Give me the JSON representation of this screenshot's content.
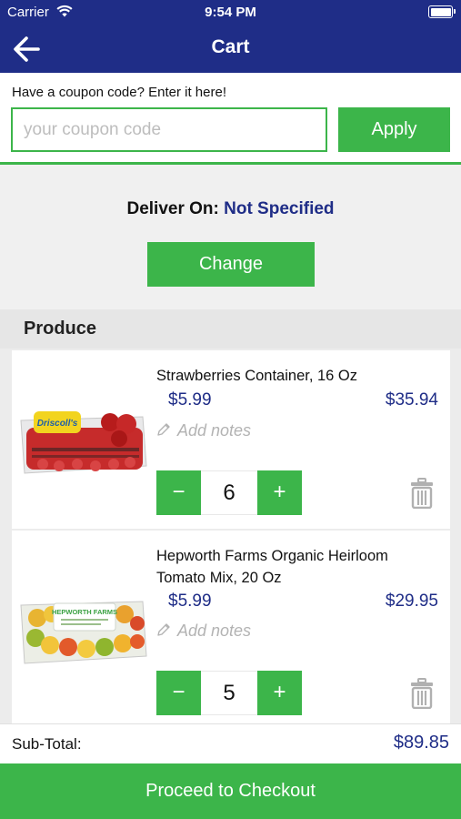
{
  "status_bar": {
    "carrier": "Carrier",
    "time": "9:54 PM"
  },
  "nav": {
    "title": "Cart",
    "back_icon": "arrow-left-icon"
  },
  "coupon": {
    "prompt": "Have a coupon code? Enter it here!",
    "placeholder": "your coupon code",
    "value": "",
    "apply_label": "Apply"
  },
  "delivery": {
    "label": "Deliver On:",
    "value": "Not Specified",
    "change_label": "Change"
  },
  "section": {
    "title": "Produce"
  },
  "items": [
    {
      "name": "Strawberries Container, 16 Oz",
      "price": "$5.99",
      "total": "$35.94",
      "notes_placeholder": "Add notes",
      "quantity": "6",
      "minus": "−",
      "plus": "+"
    },
    {
      "name": "Hepworth Farms Organic Heirloom Tomato Mix, 20 Oz",
      "price": "$5.99",
      "total": "$29.95",
      "notes_placeholder": "Add notes",
      "quantity": "5",
      "minus": "−",
      "plus": "+"
    }
  ],
  "product_images": [
    {
      "brand_text": "Driscoll's"
    },
    {
      "brand_text": "HEPWORTH FARMS"
    }
  ],
  "summary": {
    "subtotal_label": "Sub-Total:",
    "subtotal_value": "$89.85"
  },
  "checkout": {
    "label": "Proceed to Checkout"
  },
  "colors": {
    "navy": "#1f2d87",
    "green": "#3cb54a",
    "placeholder_gray": "#bdbdbd",
    "background_gray": "#f0f0f0"
  }
}
